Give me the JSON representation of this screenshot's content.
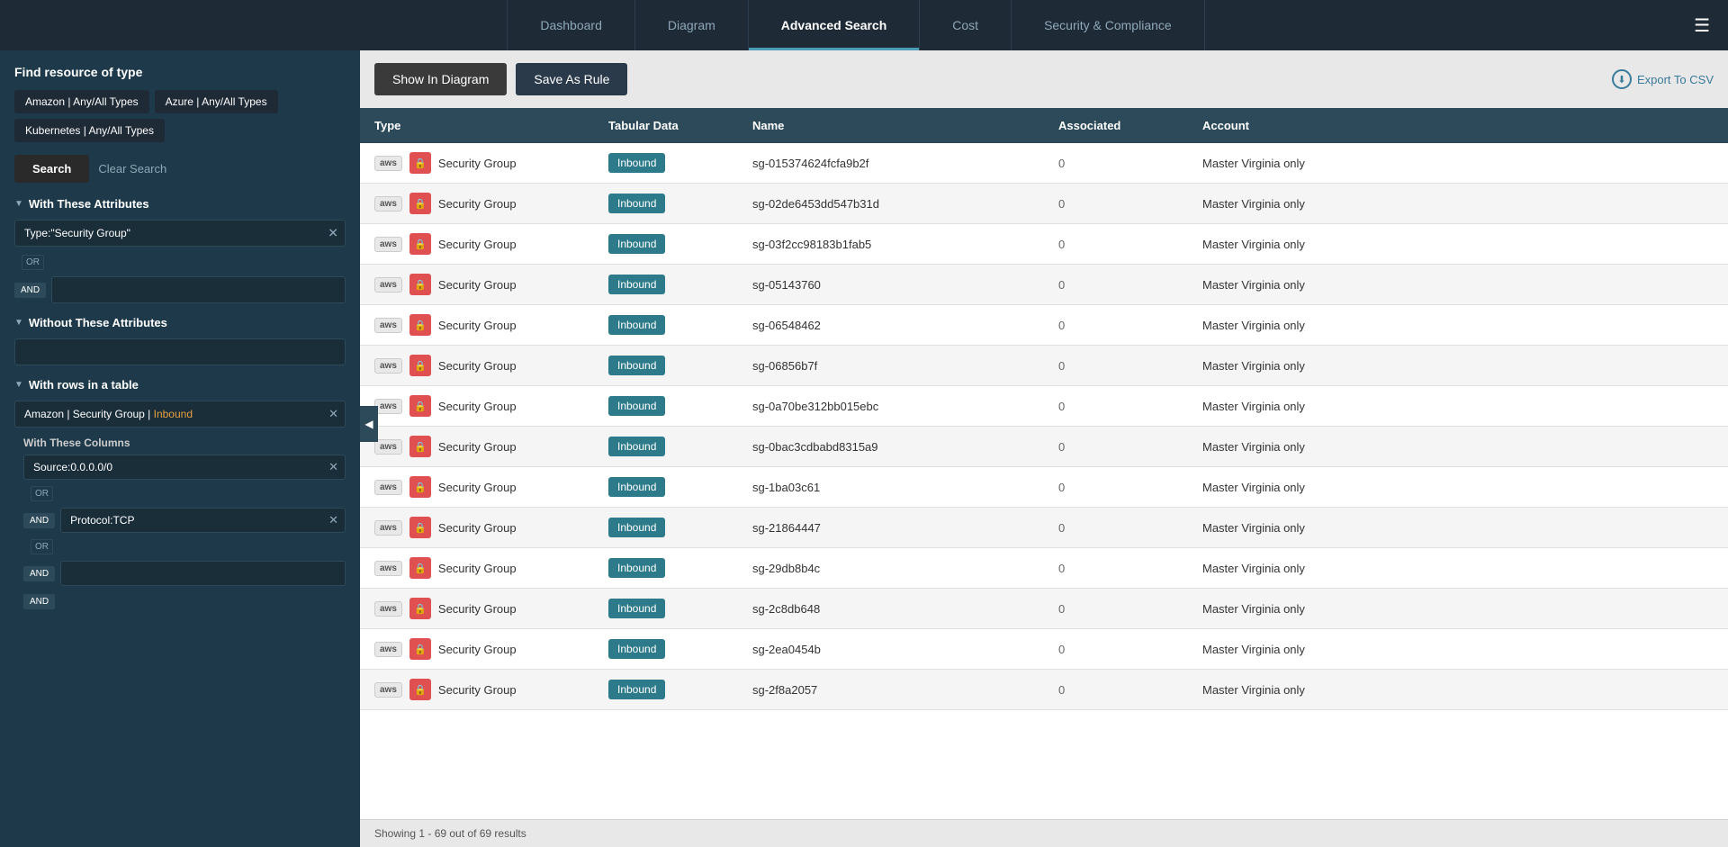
{
  "nav": {
    "items": [
      {
        "id": "dashboard",
        "label": "Dashboard",
        "active": false
      },
      {
        "id": "diagram",
        "label": "Diagram",
        "active": false
      },
      {
        "id": "advanced-search",
        "label": "Advanced Search",
        "active": true
      },
      {
        "id": "cost",
        "label": "Cost",
        "active": false
      },
      {
        "id": "security-compliance",
        "label": "Security & Compliance",
        "active": false
      }
    ]
  },
  "sidebar": {
    "find_resource_label": "Find resource of type",
    "type_buttons": [
      {
        "id": "amazon",
        "label": "Amazon | Any/All Types"
      },
      {
        "id": "azure",
        "label": "Azure | Any/All Types"
      },
      {
        "id": "kubernetes",
        "label": "Kubernetes | Any/All Types"
      }
    ],
    "search_label": "Search",
    "clear_search_label": "Clear Search",
    "with_these_attrs_label": "With These Attributes",
    "attr_value": "Type:\"Security Group\"",
    "attr_placeholder": "",
    "without_these_attrs_label": "Without These Attributes",
    "without_placeholder": "",
    "with_rows_label": "With rows in a table",
    "rows_filter_value": "Amazon | Security Group | Inbound",
    "with_these_cols_label": "With These Columns",
    "col1_value": "Source:0.0.0.0/0",
    "col2_value": "Protocol:TCP",
    "col3_placeholder": "",
    "or_label": "OR",
    "and_label": "AND"
  },
  "toolbar": {
    "show_diagram_label": "Show In Diagram",
    "save_rule_label": "Save As Rule",
    "export_label": "Export To CSV"
  },
  "table": {
    "headers": [
      "Type",
      "Tabular Data",
      "Name",
      "Associated",
      "Account"
    ],
    "rows": [
      {
        "aws": "aws",
        "type": "Security Group",
        "tabular": "Inbound",
        "name": "sg-015374624fcfa9b2f",
        "associated": "0",
        "account": "Master Virginia only"
      },
      {
        "aws": "aws",
        "type": "Security Group",
        "tabular": "Inbound",
        "name": "sg-02de6453dd547b31d",
        "associated": "0",
        "account": "Master Virginia only"
      },
      {
        "aws": "aws",
        "type": "Security Group",
        "tabular": "Inbound",
        "name": "sg-03f2cc98183b1fab5",
        "associated": "0",
        "account": "Master Virginia only"
      },
      {
        "aws": "aws",
        "type": "Security Group",
        "tabular": "Inbound",
        "name": "sg-05143760",
        "associated": "0",
        "account": "Master Virginia only"
      },
      {
        "aws": "aws",
        "type": "Security Group",
        "tabular": "Inbound",
        "name": "sg-06548462",
        "associated": "0",
        "account": "Master Virginia only"
      },
      {
        "aws": "aws",
        "type": "Security Group",
        "tabular": "Inbound",
        "name": "sg-06856b7f",
        "associated": "0",
        "account": "Master Virginia only"
      },
      {
        "aws": "aws",
        "type": "Security Group",
        "tabular": "Inbound",
        "name": "sg-0a70be312bb015ebc",
        "associated": "0",
        "account": "Master Virginia only"
      },
      {
        "aws": "aws",
        "type": "Security Group",
        "tabular": "Inbound",
        "name": "sg-0bac3cdbabd8315a9",
        "associated": "0",
        "account": "Master Virginia only"
      },
      {
        "aws": "aws",
        "type": "Security Group",
        "tabular": "Inbound",
        "name": "sg-1ba03c61",
        "associated": "0",
        "account": "Master Virginia only"
      },
      {
        "aws": "aws",
        "type": "Security Group",
        "tabular": "Inbound",
        "name": "sg-21864447",
        "associated": "0",
        "account": "Master Virginia only"
      },
      {
        "aws": "aws",
        "type": "Security Group",
        "tabular": "Inbound",
        "name": "sg-29db8b4c",
        "associated": "0",
        "account": "Master Virginia only"
      },
      {
        "aws": "aws",
        "type": "Security Group",
        "tabular": "Inbound",
        "name": "sg-2c8db648",
        "associated": "0",
        "account": "Master Virginia only"
      },
      {
        "aws": "aws",
        "type": "Security Group",
        "tabular": "Inbound",
        "name": "sg-2ea0454b",
        "associated": "0",
        "account": "Master Virginia only"
      },
      {
        "aws": "aws",
        "type": "Security Group",
        "tabular": "Inbound",
        "name": "sg-2f8a2057",
        "associated": "0",
        "account": "Master Virginia only"
      }
    ]
  },
  "status_bar": {
    "text": "Showing 1 - 69 out of 69 results"
  }
}
